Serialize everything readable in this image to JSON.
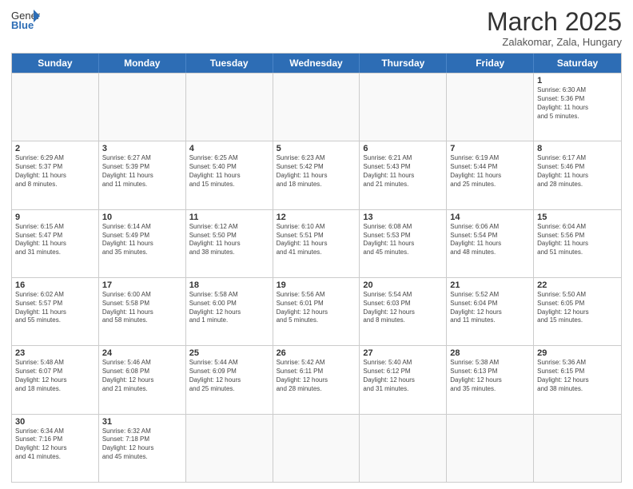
{
  "header": {
    "logo_general": "General",
    "logo_blue": "Blue",
    "title": "March 2025",
    "subtitle": "Zalakomar, Zala, Hungary"
  },
  "days": [
    "Sunday",
    "Monday",
    "Tuesday",
    "Wednesday",
    "Thursday",
    "Friday",
    "Saturday"
  ],
  "rows": [
    [
      {
        "day": "",
        "text": ""
      },
      {
        "day": "",
        "text": ""
      },
      {
        "day": "",
        "text": ""
      },
      {
        "day": "",
        "text": ""
      },
      {
        "day": "",
        "text": ""
      },
      {
        "day": "",
        "text": ""
      },
      {
        "day": "1",
        "text": "Sunrise: 6:30 AM\nSunset: 5:36 PM\nDaylight: 11 hours\nand 5 minutes."
      }
    ],
    [
      {
        "day": "2",
        "text": "Sunrise: 6:29 AM\nSunset: 5:37 PM\nDaylight: 11 hours\nand 8 minutes."
      },
      {
        "day": "3",
        "text": "Sunrise: 6:27 AM\nSunset: 5:39 PM\nDaylight: 11 hours\nand 11 minutes."
      },
      {
        "day": "4",
        "text": "Sunrise: 6:25 AM\nSunset: 5:40 PM\nDaylight: 11 hours\nand 15 minutes."
      },
      {
        "day": "5",
        "text": "Sunrise: 6:23 AM\nSunset: 5:42 PM\nDaylight: 11 hours\nand 18 minutes."
      },
      {
        "day": "6",
        "text": "Sunrise: 6:21 AM\nSunset: 5:43 PM\nDaylight: 11 hours\nand 21 minutes."
      },
      {
        "day": "7",
        "text": "Sunrise: 6:19 AM\nSunset: 5:44 PM\nDaylight: 11 hours\nand 25 minutes."
      },
      {
        "day": "8",
        "text": "Sunrise: 6:17 AM\nSunset: 5:46 PM\nDaylight: 11 hours\nand 28 minutes."
      }
    ],
    [
      {
        "day": "9",
        "text": "Sunrise: 6:15 AM\nSunset: 5:47 PM\nDaylight: 11 hours\nand 31 minutes."
      },
      {
        "day": "10",
        "text": "Sunrise: 6:14 AM\nSunset: 5:49 PM\nDaylight: 11 hours\nand 35 minutes."
      },
      {
        "day": "11",
        "text": "Sunrise: 6:12 AM\nSunset: 5:50 PM\nDaylight: 11 hours\nand 38 minutes."
      },
      {
        "day": "12",
        "text": "Sunrise: 6:10 AM\nSunset: 5:51 PM\nDaylight: 11 hours\nand 41 minutes."
      },
      {
        "day": "13",
        "text": "Sunrise: 6:08 AM\nSunset: 5:53 PM\nDaylight: 11 hours\nand 45 minutes."
      },
      {
        "day": "14",
        "text": "Sunrise: 6:06 AM\nSunset: 5:54 PM\nDaylight: 11 hours\nand 48 minutes."
      },
      {
        "day": "15",
        "text": "Sunrise: 6:04 AM\nSunset: 5:56 PM\nDaylight: 11 hours\nand 51 minutes."
      }
    ],
    [
      {
        "day": "16",
        "text": "Sunrise: 6:02 AM\nSunset: 5:57 PM\nDaylight: 11 hours\nand 55 minutes."
      },
      {
        "day": "17",
        "text": "Sunrise: 6:00 AM\nSunset: 5:58 PM\nDaylight: 11 hours\nand 58 minutes."
      },
      {
        "day": "18",
        "text": "Sunrise: 5:58 AM\nSunset: 6:00 PM\nDaylight: 12 hours\nand 1 minute."
      },
      {
        "day": "19",
        "text": "Sunrise: 5:56 AM\nSunset: 6:01 PM\nDaylight: 12 hours\nand 5 minutes."
      },
      {
        "day": "20",
        "text": "Sunrise: 5:54 AM\nSunset: 6:03 PM\nDaylight: 12 hours\nand 8 minutes."
      },
      {
        "day": "21",
        "text": "Sunrise: 5:52 AM\nSunset: 6:04 PM\nDaylight: 12 hours\nand 11 minutes."
      },
      {
        "day": "22",
        "text": "Sunrise: 5:50 AM\nSunset: 6:05 PM\nDaylight: 12 hours\nand 15 minutes."
      }
    ],
    [
      {
        "day": "23",
        "text": "Sunrise: 5:48 AM\nSunset: 6:07 PM\nDaylight: 12 hours\nand 18 minutes."
      },
      {
        "day": "24",
        "text": "Sunrise: 5:46 AM\nSunset: 6:08 PM\nDaylight: 12 hours\nand 21 minutes."
      },
      {
        "day": "25",
        "text": "Sunrise: 5:44 AM\nSunset: 6:09 PM\nDaylight: 12 hours\nand 25 minutes."
      },
      {
        "day": "26",
        "text": "Sunrise: 5:42 AM\nSunset: 6:11 PM\nDaylight: 12 hours\nand 28 minutes."
      },
      {
        "day": "27",
        "text": "Sunrise: 5:40 AM\nSunset: 6:12 PM\nDaylight: 12 hours\nand 31 minutes."
      },
      {
        "day": "28",
        "text": "Sunrise: 5:38 AM\nSunset: 6:13 PM\nDaylight: 12 hours\nand 35 minutes."
      },
      {
        "day": "29",
        "text": "Sunrise: 5:36 AM\nSunset: 6:15 PM\nDaylight: 12 hours\nand 38 minutes."
      }
    ],
    [
      {
        "day": "30",
        "text": "Sunrise: 6:34 AM\nSunset: 7:16 PM\nDaylight: 12 hours\nand 41 minutes."
      },
      {
        "day": "31",
        "text": "Sunrise: 6:32 AM\nSunset: 7:18 PM\nDaylight: 12 hours\nand 45 minutes."
      },
      {
        "day": "",
        "text": ""
      },
      {
        "day": "",
        "text": ""
      },
      {
        "day": "",
        "text": ""
      },
      {
        "day": "",
        "text": ""
      },
      {
        "day": "",
        "text": ""
      }
    ]
  ]
}
